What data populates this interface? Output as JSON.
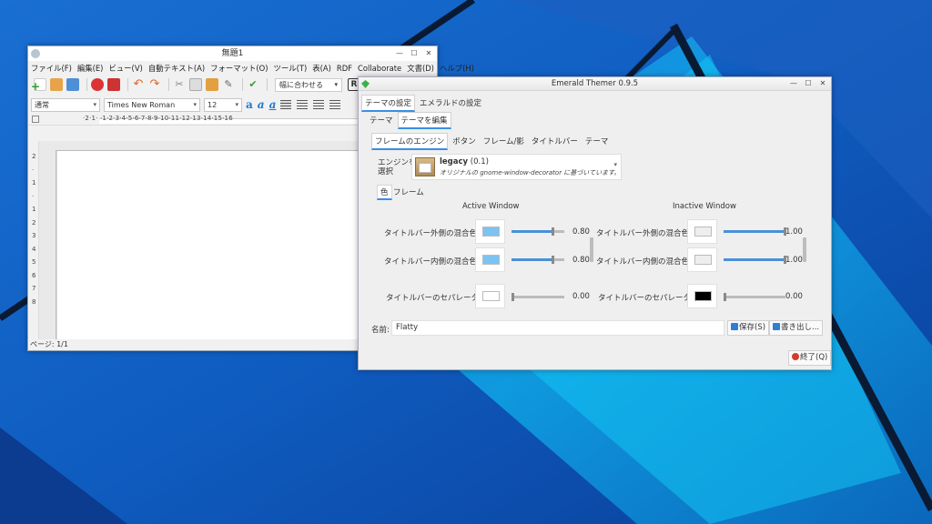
{
  "writer": {
    "title": "無題1",
    "menu": [
      "ファイル(F)",
      "編集(E)",
      "ビュー(V)",
      "自動テキスト(A)",
      "フォーマット(O)",
      "ツール(T)",
      "表(A)",
      "RDF",
      "Collaborate",
      "文書(D)",
      "ヘルプ(H)"
    ],
    "zoom": "幅に合わせる",
    "style": "通常",
    "font": "Times New Roman",
    "size": "12",
    "format_buttons": [
      "a",
      "a",
      "a"
    ],
    "ruler_numbers": "·2·1·  ·1·2·3·4·5·6·7·8·9·10·11·12·13·14·15·16",
    "vruler_numbers": [
      "2",
      "·",
      "1",
      "·",
      "1",
      "2",
      "3",
      "4",
      "5",
      "6",
      "7",
      "8"
    ],
    "status": "ページ: 1/1"
  },
  "emerald": {
    "title": "Emerald Themer 0.9.5",
    "tabs_top": [
      "テーマの設定",
      "エメラルドの設定"
    ],
    "tabs_mid": [
      "テーマ",
      "テーマを編集"
    ],
    "tabs_inner": [
      "フレームのエンジン",
      "ボタン",
      "フレーム/影",
      "タイトルバー",
      "テーマ"
    ],
    "engine_label_1": "エンジンを",
    "engine_label_2": "選択",
    "engine_name": "legacy",
    "engine_version": "(0.1)",
    "engine_desc": "オリジナルの gnome-window-decorator に基づいています。",
    "subtabs": [
      "色",
      "フレーム"
    ],
    "active_header": "Active Window",
    "inactive_header": "Inactive Window",
    "rows": [
      {
        "label": "タイトルバー外側の混合色",
        "active_color": "#7cc3f2",
        "active_value": "0.80",
        "active_level": 0.8,
        "inactive_color": "#eeeeee",
        "inactive_value": "1.00",
        "inactive_level": 1.0
      },
      {
        "label": "タイトルバー内側の混合色",
        "active_color": "#7cc3f2",
        "active_value": "0.80",
        "active_level": 0.8,
        "inactive_color": "#eeeeee",
        "inactive_value": "1.00",
        "inactive_level": 1.0
      },
      {
        "label": "タイトルバーのセパレータ",
        "active_color": "#ffffff",
        "active_value": "0.00",
        "active_level": 0.0,
        "inactive_color": "#000000",
        "inactive_value": "0.00",
        "inactive_level": 0.0
      }
    ],
    "name_label": "名前:",
    "name_value": "Flatty",
    "save_label": "保存(S)",
    "export_label": "書き出し...",
    "quit_label": "終了(Q)"
  }
}
